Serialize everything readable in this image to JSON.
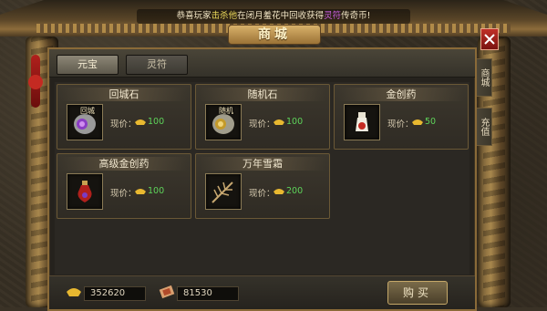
{
  "announcement": {
    "prefix": "恭喜玩家",
    "player": "击杀他",
    "middle": "在闭月羞花中回收获得",
    "item": "灵符",
    "suffix": "传奇币!"
  },
  "window": {
    "title": "商城"
  },
  "tabs": [
    {
      "label": "元宝",
      "active": true
    },
    {
      "label": "灵符",
      "active": false
    }
  ],
  "side_tabs": [
    {
      "label": "商城"
    },
    {
      "label": "充值"
    }
  ],
  "items": [
    {
      "name": "回城石",
      "icon_label": "回城",
      "icon": "scroll-icon",
      "price_label": "现价：",
      "price": "100"
    },
    {
      "name": "随机石",
      "icon_label": "随机",
      "icon": "scroll-icon",
      "price_label": "现价：",
      "price": "100"
    },
    {
      "name": "金创药",
      "icon_label": "",
      "icon": "potion-icon",
      "price_label": "现价：",
      "price": "50"
    },
    {
      "name": "高级金创药",
      "icon_label": "",
      "icon": "red-potion-icon",
      "price_label": "现价：",
      "price": "100"
    },
    {
      "name": "万年雪霜",
      "icon_label": "",
      "icon": "herb-icon",
      "price_label": "现价：",
      "price": "200"
    }
  ],
  "currencies": {
    "gold_ingot": "352620",
    "talisman": "81530"
  },
  "buttons": {
    "buy": "购买"
  },
  "colors": {
    "price_green": "#5ed45a",
    "frame_gold": "#8a6a38",
    "close_red": "#c03028"
  }
}
